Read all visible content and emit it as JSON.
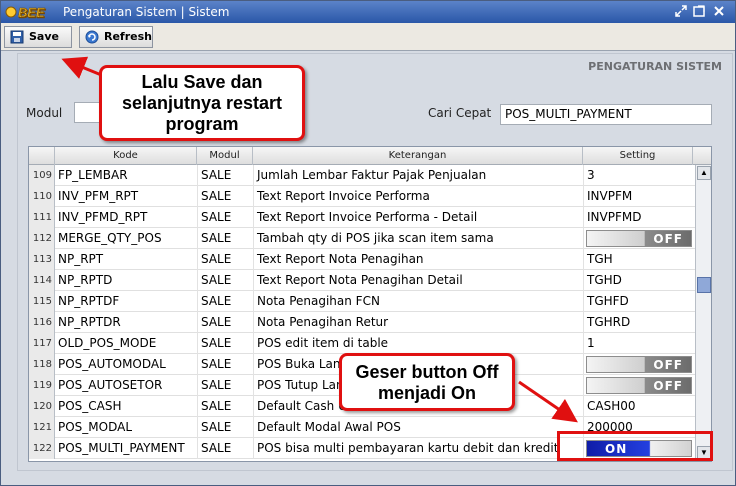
{
  "window": {
    "logo_text": "BEE",
    "title": "Pengaturan Sistem | Sistem",
    "controls": [
      "restore-icon",
      "maximize-icon",
      "close-icon"
    ]
  },
  "toolbar": {
    "save_label": "Save",
    "refresh_label": "Refresh"
  },
  "section_title": "PENGATURAN SISTEM",
  "filters": {
    "modul_label": "Modul",
    "modul_value": "",
    "search_label": "Cari Cepat",
    "search_value": "POS_MULTI_PAYMENT"
  },
  "table": {
    "columns": [
      "Kode",
      "Modul",
      "Keterangan",
      "Setting"
    ],
    "rows": [
      {
        "no": "109",
        "kode": "FP_LEMBAR",
        "modul": "SALE",
        "ket": "Jumlah Lembar Faktur Pajak Penjualan",
        "setting": "3",
        "toggle": null
      },
      {
        "no": "110",
        "kode": "INV_PFM_RPT",
        "modul": "SALE",
        "ket": "Text Report Invoice Performa",
        "setting": "INVPFM",
        "toggle": null
      },
      {
        "no": "111",
        "kode": "INV_PFMD_RPT",
        "modul": "SALE",
        "ket": "Text Report Invoice Performa - Detail",
        "setting": "INVPFMD",
        "toggle": null
      },
      {
        "no": "112",
        "kode": "MERGE_QTY_POS",
        "modul": "SALE",
        "ket": "Tambah qty di POS jika scan item sama",
        "setting": "OFF",
        "toggle": "off"
      },
      {
        "no": "113",
        "kode": "NP_RPT",
        "modul": "SALE",
        "ket": "Text Report Nota Penagihan",
        "setting": "TGH",
        "toggle": null
      },
      {
        "no": "114",
        "kode": "NP_RPTD",
        "modul": "SALE",
        "ket": "Text Report Nota Penagihan Detail",
        "setting": "TGHD",
        "toggle": null
      },
      {
        "no": "115",
        "kode": "NP_RPTDF",
        "modul": "SALE",
        "ket": "Nota Penagihan FCN",
        "setting": "TGHFD",
        "toggle": null
      },
      {
        "no": "116",
        "kode": "NP_RPTDR",
        "modul": "SALE",
        "ket": "Nota Penagihan Retur",
        "setting": "TGHRD",
        "toggle": null
      },
      {
        "no": "117",
        "kode": "OLD_POS_MODE",
        "modul": "SALE",
        "ket": "POS edit item di table",
        "setting": "1",
        "toggle": null
      },
      {
        "no": "118",
        "kode": "POS_AUTOMODAL",
        "modul": "SALE",
        "ket": "POS Buka Lan",
        "setting": "OFF",
        "toggle": "off"
      },
      {
        "no": "119",
        "kode": "POS_AUTOSETOR",
        "modul": "SALE",
        "ket": "POS Tutup Lan",
        "setting": "OFF",
        "toggle": "off"
      },
      {
        "no": "120",
        "kode": "POS_CASH",
        "modul": "SALE",
        "ket": "Default Cash U",
        "setting": "CASH00",
        "toggle": null
      },
      {
        "no": "121",
        "kode": "POS_MODAL",
        "modul": "SALE",
        "ket": "Default Modal Awal POS",
        "setting": "200000",
        "toggle": null
      },
      {
        "no": "122",
        "kode": "POS_MULTI_PAYMENT",
        "modul": "SALE",
        "ket": "POS bisa multi pembayaran kartu debit dan kredit",
        "setting": "ON",
        "toggle": "on"
      }
    ]
  },
  "annotations": {
    "callout_save": "Lalu Save dan selanjutnya restart program",
    "callout_toggle": "Geser button Off menjadi On"
  },
  "colors": {
    "annotation_red": "#e01010",
    "toggle_on_blue": "#1a2cc8"
  }
}
